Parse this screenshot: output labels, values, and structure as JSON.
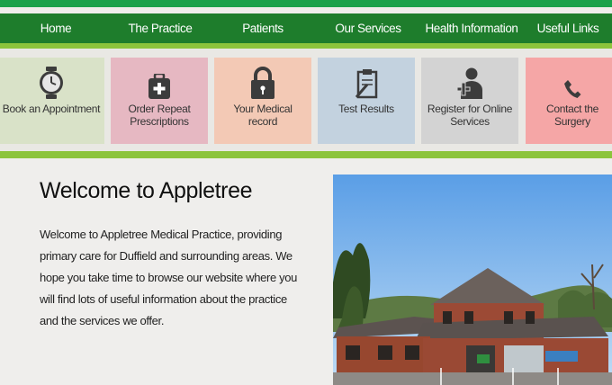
{
  "nav": {
    "items": [
      {
        "label": "Home"
      },
      {
        "label": "The Practice"
      },
      {
        "label": "Patients"
      },
      {
        "label": "Our Services"
      },
      {
        "label": "Health Information"
      },
      {
        "label": "Useful Links"
      }
    ]
  },
  "tiles": [
    {
      "label": "Book an Appointment",
      "icon": "clock-icon",
      "color": "#d9e2c8"
    },
    {
      "label": "Order Repeat\nPrescriptions",
      "icon": "medicine-bag-icon",
      "color": "#e6b8c2"
    },
    {
      "label": "Your Medical record",
      "icon": "padlock-icon",
      "color": "#f3c9b5"
    },
    {
      "label": "Test Results",
      "icon": "clipboard-icon",
      "color": "#c3d2df"
    },
    {
      "label": "Register for Online\nServices",
      "icon": "user-add-icon",
      "color": "#d3d3d3"
    },
    {
      "label": "Contact the Surgery",
      "icon": "phone-icon",
      "color": "#f5a6a6"
    }
  ],
  "welcome": {
    "title": "Welcome to Appletree",
    "body": "Welcome to Appletree Medical Practice, providing primary care for Duffield and surrounding areas. We hope you take time to browse our website where you will find lots of useful information about the practice and the services we offer."
  }
}
